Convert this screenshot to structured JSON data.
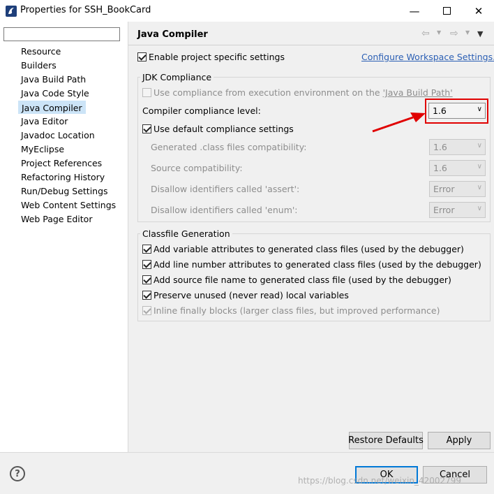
{
  "window": {
    "title": "Properties for SSH_BookCard",
    "minimize_icon": "minimize-icon",
    "maximize_icon": "maximize-icon",
    "close_icon": "close-icon"
  },
  "sidebar": {
    "filter_value": "",
    "items": [
      {
        "label": "Resource"
      },
      {
        "label": "Builders"
      },
      {
        "label": "Java Build Path"
      },
      {
        "label": "Java Code Style"
      },
      {
        "label": "Java Compiler",
        "selected": true
      },
      {
        "label": "Java Editor"
      },
      {
        "label": "Javadoc Location"
      },
      {
        "label": "MyEclipse"
      },
      {
        "label": "Project References"
      },
      {
        "label": "Refactoring History"
      },
      {
        "label": "Run/Debug Settings"
      },
      {
        "label": "Web Content Settings"
      },
      {
        "label": "Web Page Editor"
      }
    ]
  },
  "header": {
    "title": "Java Compiler",
    "back_icon": "back-arrow-icon",
    "forward_icon": "forward-arrow-icon",
    "menu_icon": "view-menu-icon"
  },
  "main": {
    "enable_project_settings": {
      "label": "Enable project specific settings",
      "checked": true
    },
    "configure_link": "Configure Workspace Settings...",
    "jdk": {
      "group_title": "JDK Compliance",
      "use_env_compliance_prefix": "Use compliance from execution environment on the ",
      "use_env_compliance_link": "'Java Build Path'",
      "compliance_level_label": "Compiler compliance level:",
      "compliance_level_value": "1.6",
      "use_default_compliance": "Use default compliance settings",
      "class_compat_label": "Generated .class files compatibility:",
      "class_compat_value": "1.6",
      "source_compat_label": "Source compatibility:",
      "source_compat_value": "1.6",
      "assert_label": "Disallow identifiers called 'assert':",
      "assert_value": "Error",
      "enum_label": "Disallow identifiers called 'enum':",
      "enum_value": "Error"
    },
    "classfile": {
      "group_title": "Classfile Generation",
      "opt1": "Add variable attributes to generated class files (used by the debugger)",
      "opt2": "Add line number attributes to generated class files (used by the debugger)",
      "opt3": "Add source file name to generated class file (used by the debugger)",
      "opt4": "Preserve unused (never read) local variables",
      "opt5": "Inline finally blocks (larger class files, but improved performance)"
    },
    "restore_defaults": "Restore Defaults",
    "apply": "Apply"
  },
  "footer": {
    "help_icon": "help-icon",
    "help_glyph": "?",
    "ok": "OK",
    "cancel": "Cancel",
    "watermark": "https://blog.csdn.net/weixin_42002799"
  },
  "colors": {
    "accent": "#0078d7",
    "highlight": "#e00000",
    "selection": "#cce4f7",
    "link": "#2b5fb4"
  }
}
